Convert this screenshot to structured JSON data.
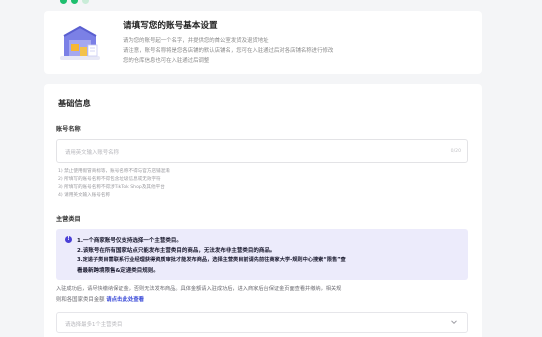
{
  "intro": {
    "title": "请填写您的账号基本设置",
    "lines": [
      "请为您的账号起一个名字，并提供您的首公室发货及退货地址",
      "请注意，账号名称将是您各店铺的默认店铺名，您可在入驻通过后对各店铺名称进行修改",
      "您的仓库信息也可在入驻通过后调整"
    ]
  },
  "main": {
    "section_title": "基础信息",
    "account_name": {
      "label": "账号名称",
      "placeholder": "请用英文输入账号名称",
      "counter": "0/20",
      "hints": [
        "1) 禁止使用假冒商标等，账号名称不得与官方店铺混淆",
        "2) 所填写的账号名称不得包含垃圾信息或无效字符",
        "3) 所填写的账号名称不得涉TikTok Shop及其他平台",
        "4) 请用英文输入账号名称"
      ]
    },
    "category": {
      "label": "主营类目",
      "notice_lines": [
        "1.一个商家账号仅支持选择一个主营类目。",
        "2.该账号在所有国家站点只能发布主营类目的商品，无法发布非主营类目的商品。",
        "3.定递子类目需联系行业经理获得资质审批才能发布商品，选择主营类目前请先前往商家大学-规则中心搜索“限售”查",
        "看最新跨境限售&定递类目规则。"
      ],
      "after_lines": [
        "入驻成功后，请尽快缴纳保证金，否则无法发布商品。具体金额请入驻成功后，进入商家后台保证金页面查看并缴纳，相关规",
        "则和各国家类目金额"
      ],
      "link_text": "请点击此处查看",
      "select_placeholder": "请选择最多1个主营类目"
    }
  },
  "colors": {
    "accent": "#4a3fd6",
    "notice_bg": "#ecebfb",
    "link": "#3b4bd8",
    "brand_green": "#1fbf6f"
  }
}
